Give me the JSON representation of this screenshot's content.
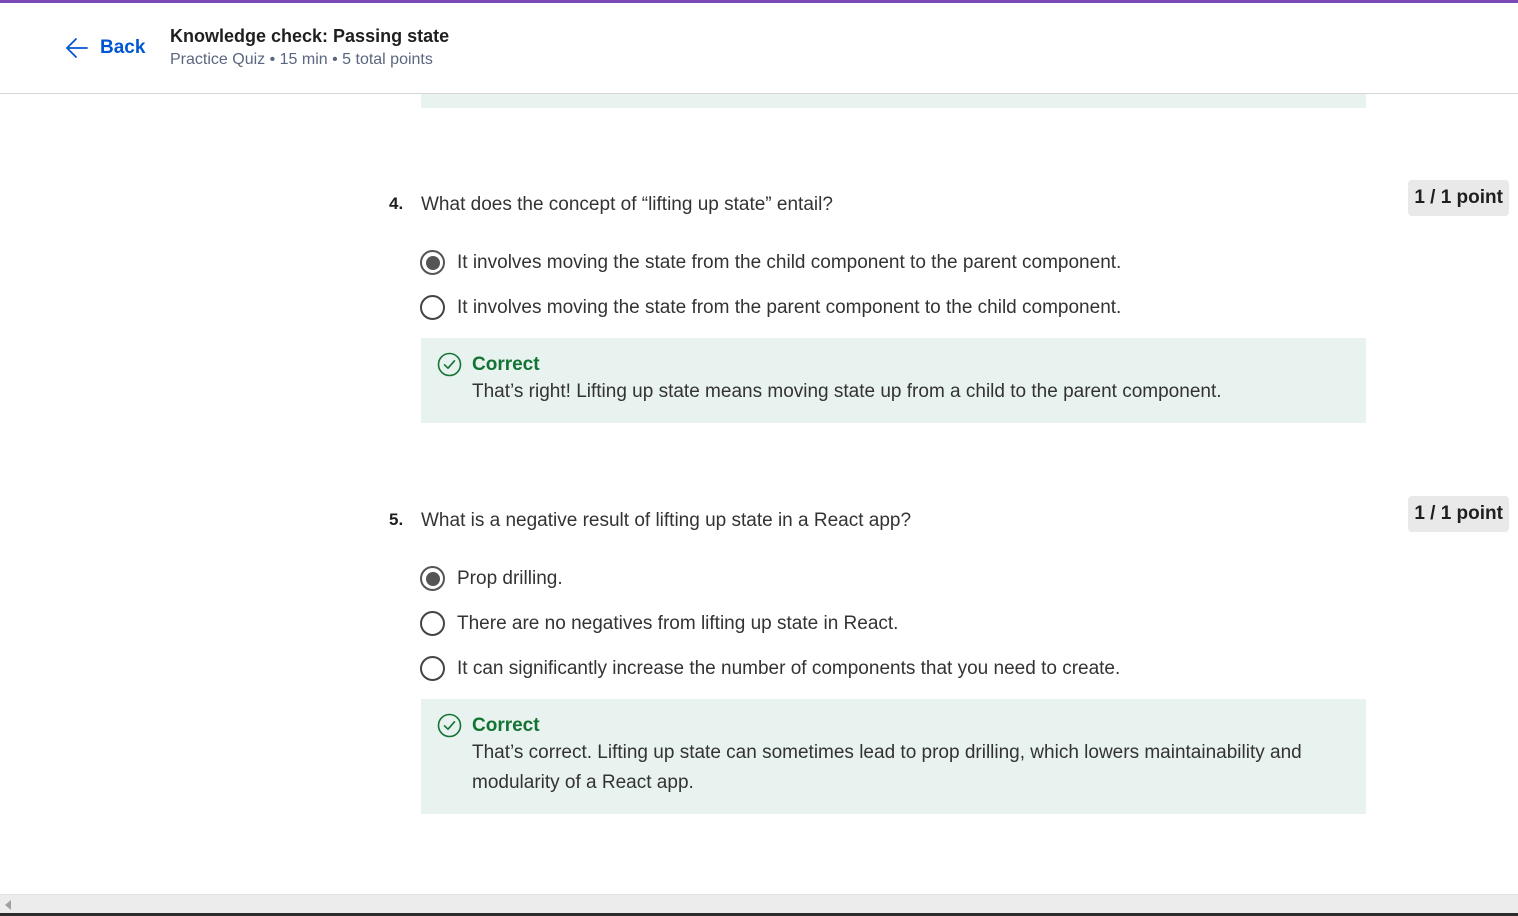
{
  "header": {
    "back_label": "Back",
    "title": "Knowledge check: Passing state",
    "meta": "Practice Quiz • 15 min • 5 total points"
  },
  "questions": [
    {
      "number": "4.",
      "text": "What does the concept of “lifting up state” entail?",
      "points": "1 / 1 point",
      "options": [
        {
          "label": "It involves moving the state from the child component to the parent component.",
          "selected": true
        },
        {
          "label": "It involves moving the state from the parent component to the child component.",
          "selected": false
        }
      ],
      "feedback": {
        "title": "Correct",
        "text": "That’s right! Lifting up state means moving state up from a child to the parent component."
      }
    },
    {
      "number": "5.",
      "text": "What is a negative result of lifting up state in a React app?",
      "points": "1 / 1 point",
      "options": [
        {
          "label": "Prop drilling.",
          "selected": true
        },
        {
          "label": "There are no negatives from lifting up state in React.",
          "selected": false
        },
        {
          "label": "It can significantly increase the number of components that you need to create.",
          "selected": false
        }
      ],
      "feedback": {
        "title": "Correct",
        "text_line1": "That’s correct. Lifting up state can sometimes lead to prop drilling, which lowers maintainability and",
        "text_line2": "modularity of a React app."
      }
    }
  ],
  "colors": {
    "accent": "#7b4bb5",
    "link": "#0056d2",
    "correct": "#137333",
    "feedback_bg": "#e8f2ee"
  }
}
